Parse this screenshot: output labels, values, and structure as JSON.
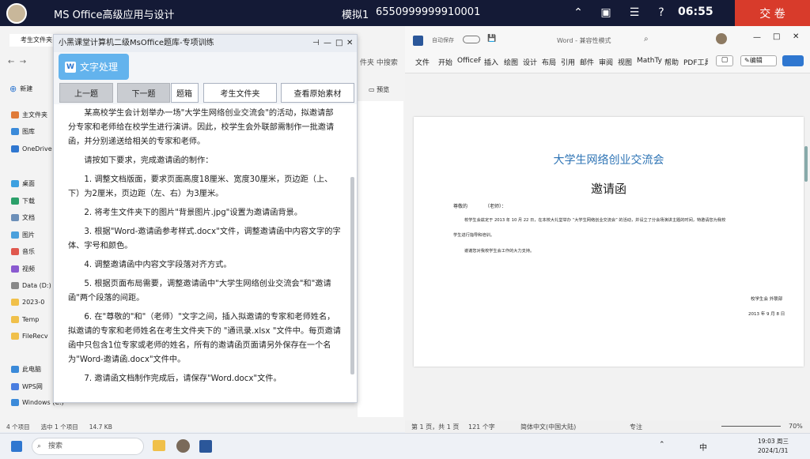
{
  "topbar": {
    "app_title": "MS Office高级应用与设计",
    "exam": "模拟1",
    "exam_id": "6550999999910001",
    "time": "06:55",
    "submit": "交 卷"
  },
  "explorer": {
    "tab": "考生文件夹",
    "new": "新建",
    "search_hint": "件夹 中搜索",
    "preview": "预览",
    "side": [
      "主文件夹",
      "图库",
      "OneDrive",
      "桌面",
      "下载",
      "文档",
      "图片",
      "音乐",
      "视频",
      "Data (D:)",
      "2023-0",
      "Temp",
      "FileRecv",
      "此电脑",
      "WPS网",
      "Windows (C:)"
    ],
    "status": [
      "4 个项目",
      "选中 1 个项目",
      "14.7 KB"
    ]
  },
  "panel": {
    "title": "小黑课堂计算机二级MsOffice题库-专项训练",
    "category": "文字处理",
    "prev": "上一题",
    "next": "下一题",
    "mail": "题箱",
    "folder": "考生文件夹",
    "material": "查看原始素材",
    "intro": "某高校学生会计划举办一场\"大学生网络创业交流会\"的活动，拟邀请部分专家和老师给在校学生进行演讲。因此，校学生会外联部需制作一批邀请函，并分别递送给相关的专家和老师。",
    "req": "请按如下要求，完成邀请函的制作：",
    "items": [
      "1. 调整文档版面，要求页面高度18厘米、宽度30厘米，页边距（上、下）为2厘米，页边距（左、右）为3厘米。",
      "2. 将考生文件夹下的图片\"背景图片.jpg\"设置为邀请函背景。",
      "3. 根据\"Word-邀请函参考样式.docx\"文件，调整邀请函中内容文字的字体、字号和颜色。",
      "4. 调整邀请函中内容文字段落对齐方式。",
      "5. 根据页面布局需要，调整邀请函中\"大学生网络创业交流会\"和\"邀请函\"两个段落的间距。",
      "6. 在\"尊敬的\"和\"（老师）\"文字之间，插入拟邀请的专家和老师姓名，拟邀请的专家和老师姓名在考生文件夹下的 \"通讯录.xlsx \"文件中。每页邀请函中只包含1位专家或老师的姓名，所有的邀请函页面请另外保存在一个名为\"Word-邀请函.docx\"文件中。",
      "7. 邀请函文档制作完成后，请保存\"Word.docx\"文件。"
    ]
  },
  "word": {
    "autosave": "自动保存",
    "filename": "Word - 兼容性模式",
    "menus": [
      "文件",
      "开始",
      "OfficeP",
      "插入",
      "绘图",
      "设计",
      "布局",
      "引用",
      "邮件",
      "审阅",
      "视图",
      "MathTy",
      "帮助",
      "PDF工具"
    ],
    "edit": "编辑",
    "doc": {
      "heading": "大学生网络创业交流会",
      "title": "邀请函",
      "greet": "尊敬的",
      "greet2": "（老师）：",
      "body1": "校学生会兹定于 2013 年 10 月 22 日，在本校大礼堂举办 “大学生网络创业交流会” 的活动，并设立了分会场演讲主题的时间，特邀请您为我校",
      "body2": "学生进行指导和培训。",
      "body3": "谢谢您对我校学生会工作的大力支持。",
      "sign": "校学生会  外联部",
      "date": "2013 年 9 月 8 日"
    },
    "status": {
      "page": "第 1 页，共 1 页",
      "words": "121 个字",
      "lang": "简体中文(中国大陆)",
      "focus": "专注",
      "zoom": "70%"
    }
  },
  "taskbar": {
    "search": "搜索",
    "time": "19:03 周三",
    "date": "2024/1/31",
    "ime": "中"
  },
  "colors": {
    "topbar": "#141a36",
    "submit": "#d83b2b",
    "accent": "#2f77d0",
    "word_heading": "#2e74b5"
  }
}
